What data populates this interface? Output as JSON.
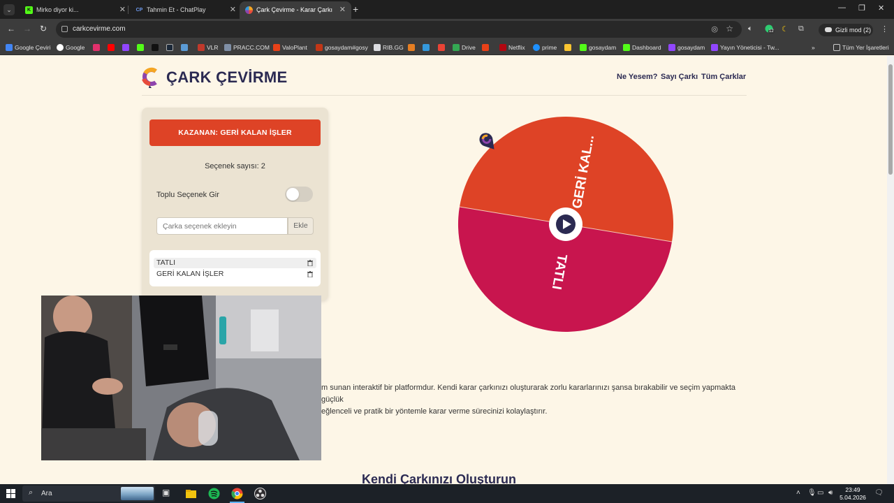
{
  "browser": {
    "tabs": [
      {
        "title": "Mirko diyor ki...",
        "icon": "kick-icon",
        "color": "#53fc18",
        "active": false
      },
      {
        "title": "Tahmin Et - ChatPlay",
        "icon": "chatplay-icon",
        "color": "#4b7bec",
        "active": false
      },
      {
        "title": "Çark Çevirme - Karar Çarkı",
        "icon": "wheel-icon",
        "color": "#8e44ad",
        "active": true
      }
    ],
    "url": "carkcevirme.com",
    "incognito_label": "Gizli mod (2)",
    "extension_badge": "12",
    "bookmarks": [
      "Google Çeviri",
      "Google",
      "VLR",
      "PRACC.COM",
      "ValoPlant",
      "gosaydam#gosy",
      "RIB.GG",
      "Drive",
      "Netflix",
      "prime",
      "gosaydam",
      "Dashboard",
      "gosaydam",
      "Yayın Yöneticisi - Tw..."
    ],
    "all_bookmarks_label": "Tüm Yer İşaretleri"
  },
  "site": {
    "brand": "ÇARK ÇEVİRME",
    "nav": [
      "Ne Yesem?",
      "Sayı Çarkı",
      "Tüm Çarklar"
    ],
    "winner_label": "KAZANAN: GERİ KALAN İŞLER",
    "option_count": "Seçenek sayısı: 2",
    "bulk_toggle_label": "Toplu Seçenek Gir",
    "bulk_toggle_on": false,
    "add_placeholder": "Çarka seçenek ekleyin",
    "add_button": "Ekle",
    "options": [
      "TATLI",
      "GERİ KALAN İŞLER"
    ],
    "description_line1": "m sunan interaktif bir platformdur. Kendi karar çarkınızı oluşturarak zorlu kararlarınızı şansa bırakabilir ve seçim yapmakta güçlük",
    "description_line2": "eğlenceli ve pratik bir yöntemle karar verme sürecinizi kolaylaştırır.",
    "section_heading": "Kendi Çarkınızı Oluşturun"
  },
  "wheel": {
    "segments": [
      {
        "label": "GERİ KAL...",
        "color": "#de4326"
      },
      {
        "label": "TATLI",
        "color": "#c8154e"
      }
    ],
    "center_icon": "play-icon"
  },
  "taskbar": {
    "search_label": "Ara",
    "time": "23:49",
    "date": "5.04.2026"
  },
  "colors": {
    "page_bg": "#fdf6e7",
    "brand_navy": "#2b2a52",
    "accent_orange": "#de4326",
    "accent_crimson": "#c8154e"
  }
}
